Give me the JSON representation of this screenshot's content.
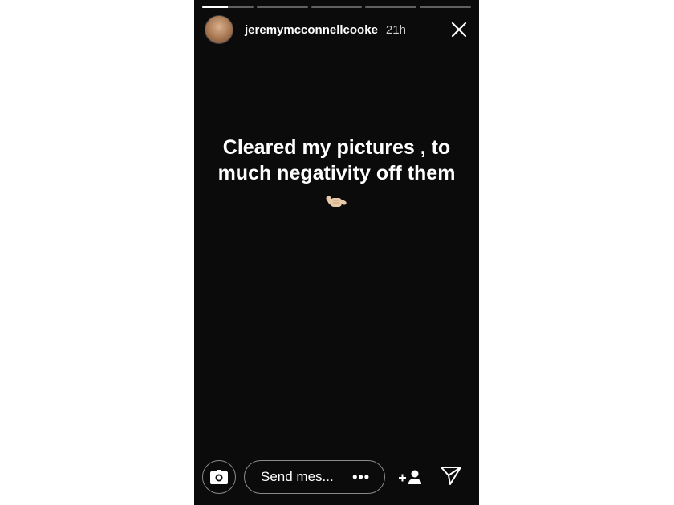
{
  "story": {
    "progress_segments": [
      0.5,
      0,
      0,
      0,
      0
    ],
    "username": "jeremymcconnellcooke",
    "time_ago": "21h",
    "text_lines": [
      "Cleared my pictures , to",
      "much negativity off them"
    ],
    "emoji": "🤙🏼",
    "background_color": "#0b0b0b"
  },
  "reply_bar": {
    "placeholder": "Send mes...",
    "more": "•••",
    "icons": [
      "camera-icon",
      "add-user-icon",
      "send-icon"
    ]
  }
}
